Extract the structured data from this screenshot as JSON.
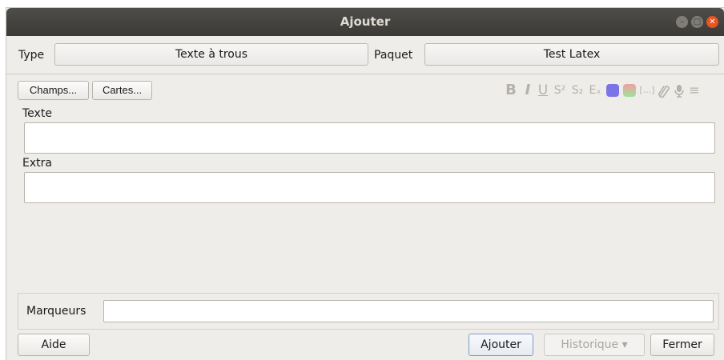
{
  "window": {
    "title": "Ajouter"
  },
  "type_row": {
    "type_label": "Type",
    "type_value": "Texte à trous",
    "deck_label": "Paquet",
    "deck_value": "Test Latex"
  },
  "toolbar": {
    "fields_button": "Champs...",
    "cards_button": "Cartes...",
    "format_buttons": [
      {
        "name": "bold",
        "glyph": "B"
      },
      {
        "name": "italic",
        "glyph": "I"
      },
      {
        "name": "underline",
        "glyph": "U"
      },
      {
        "name": "superscript",
        "glyph": "S²"
      },
      {
        "name": "subscript",
        "glyph": "S₂"
      },
      {
        "name": "clear-format",
        "glyph": "Eₓ"
      },
      {
        "name": "cloze",
        "glyph": "[...]"
      },
      {
        "name": "more",
        "glyph": "≡"
      }
    ],
    "colors": {
      "text_color": "#7b73e6",
      "highlight_gradient": [
        "#f0a0a0",
        "#a0e0a0"
      ]
    }
  },
  "fields": [
    {
      "label": "Texte",
      "value": ""
    },
    {
      "label": "Extra",
      "value": ""
    }
  ],
  "tags": {
    "label": "Marqueurs",
    "value": ""
  },
  "footer": {
    "help_button": "Aide",
    "add_button": "Ajouter",
    "history_button": "Historique ▾",
    "close_button": "Fermer"
  }
}
